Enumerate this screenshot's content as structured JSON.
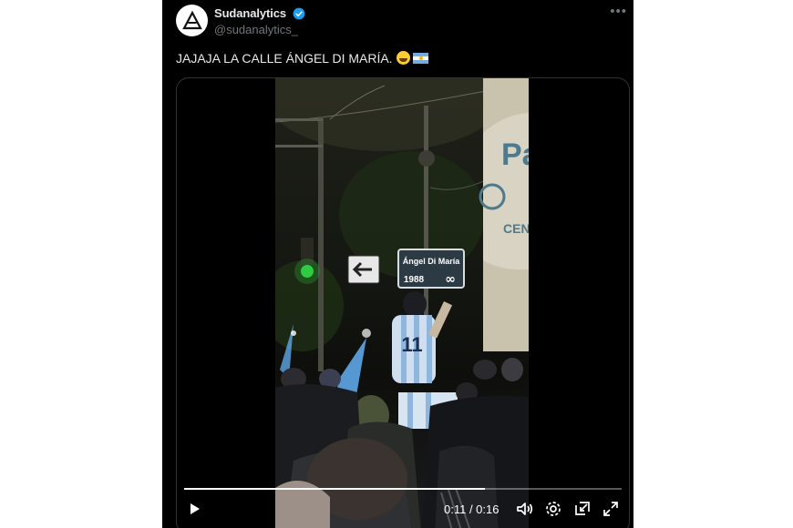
{
  "post": {
    "display_name": "Sudanalytics",
    "handle": "@sudanalytics_",
    "verified": true,
    "text": "JAJAJA LA CALLE ÁNGEL DI MARÍA.",
    "emojis": [
      "grinning-sweat-emoji",
      "argentina-flag-emoji"
    ]
  },
  "video": {
    "street_sign_name": "Ángel Di María",
    "street_sign_year": "1988",
    "street_sign_symbol": "∞",
    "jersey_number": "11",
    "storefront_text": "Pa",
    "storefront_text_2": "CEN",
    "current_time": "0:11",
    "duration": "0:16",
    "time_display": "0:11 / 0:16",
    "progress": 0.6875
  },
  "colors": {
    "background": "#000000",
    "text_primary": "#e7e9ea",
    "text_secondary": "#71767b",
    "verified_blue": "#1d9bf0",
    "traffic_light_green": "#2ecc40",
    "flag_blue": "#74acdf"
  }
}
